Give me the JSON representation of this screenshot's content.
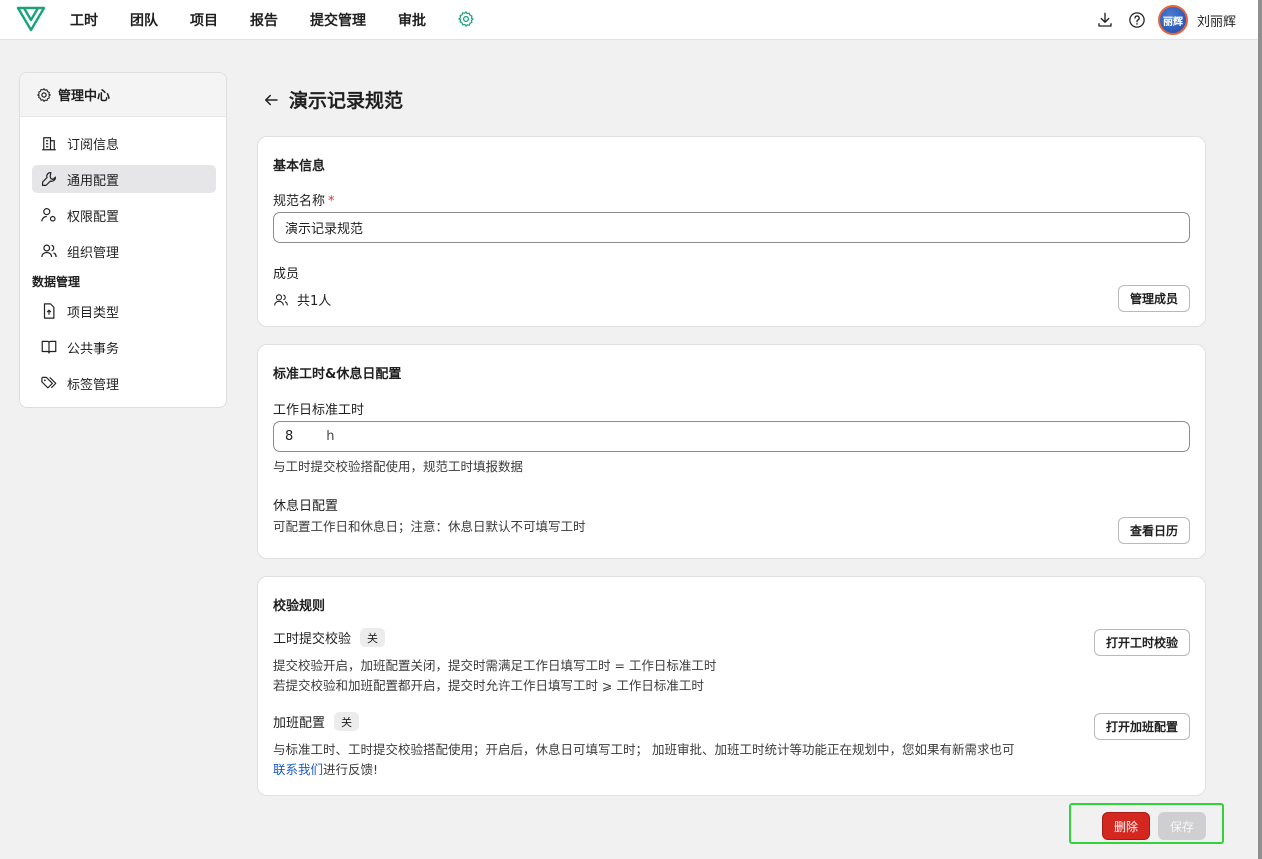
{
  "nav": {
    "items": [
      "工时",
      "团队",
      "项目",
      "报告",
      "提交管理",
      "审批"
    ],
    "settings_icon": "gear-icon",
    "accent": "#1aa37a"
  },
  "user": {
    "avatar_text": "丽辉",
    "name": "刘丽辉"
  },
  "sidebar": {
    "title": "管理中心",
    "items": [
      {
        "label": "订阅信息",
        "icon": "building-icon"
      },
      {
        "label": "通用配置",
        "icon": "wrench-icon",
        "active": true
      },
      {
        "label": "权限配置",
        "icon": "user-key-icon"
      },
      {
        "label": "组织管理",
        "icon": "users-icon"
      }
    ],
    "section_label": "数据管理",
    "data_items": [
      {
        "label": "项目类型",
        "icon": "file-upload-icon"
      },
      {
        "label": "公共事务",
        "icon": "book-icon"
      },
      {
        "label": "标签管理",
        "icon": "tags-icon"
      }
    ]
  },
  "page": {
    "title": "演示记录规范"
  },
  "basic": {
    "title": "基本信息",
    "name_label": "规范名称",
    "required_mark": "*",
    "name_value": "演示记录规范",
    "members_label": "成员",
    "members_count": "共1人",
    "manage_members_btn": "管理成员"
  },
  "hours": {
    "title": "标准工时&休息日配置",
    "workday_label": "工作日标准工时",
    "workday_value": "8",
    "workday_unit": "h",
    "workday_hint": "与工时提交校验搭配使用，规范工时填报数据",
    "rest_label": "休息日配置",
    "rest_hint": "可配置工作日和休息日；注意：休息日默认不可填写工时",
    "calendar_btn": "查看日历"
  },
  "rules": {
    "title": "校验规则",
    "submit_check_label": "工时提交校验",
    "submit_check_state": "关",
    "submit_check_hint1": "提交校验开启，加班配置关闭，提交时需满足工作日填写工时 = 工作日标准工时",
    "submit_check_hint2": "若提交校验和加班配置都开启，提交时允许工作日填写工时 ⩾ 工作日标准工时",
    "submit_check_btn": "打开工时校验",
    "overtime_label": "加班配置",
    "overtime_state": "关",
    "overtime_hint": "与标准工时、工时提交校验搭配使用；开启后，休息日可填写工时；  加班审批、加班工时统计等功能正在规划中，您如果有新需求也可",
    "contact_link": "联系我们",
    "feedback_suffix": "进行反馈!",
    "overtime_btn": "打开加班配置"
  },
  "actions": {
    "delete_label": "删除",
    "save_label": "保存",
    "delete_color": "#d3271f",
    "highlight_color": "#32d23c"
  }
}
